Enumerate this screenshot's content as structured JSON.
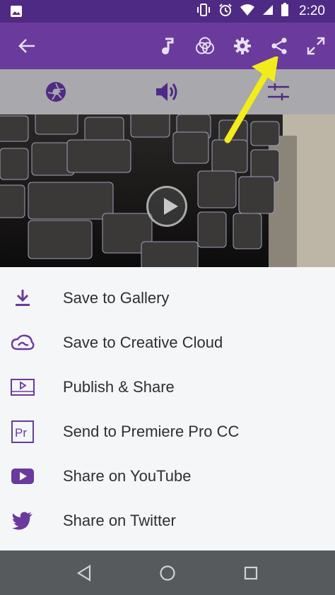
{
  "status_bar": {
    "time": "2:20",
    "icons": [
      "image-icon",
      "vibrate-icon",
      "alarm-icon",
      "wifi-icon",
      "signal-icon",
      "battery-icon"
    ]
  },
  "toolbar": {
    "icons": [
      "back-arrow-icon",
      "music-icon",
      "color-filter-icon",
      "settings-icon",
      "share-icon",
      "fullscreen-icon"
    ]
  },
  "tabs": {
    "icons": [
      "aperture-icon",
      "volume-icon",
      "adjust-sliders-icon"
    ]
  },
  "video": {
    "icons": [
      "play-icon"
    ]
  },
  "share_menu": {
    "items": [
      {
        "label": "Save to Gallery",
        "icon": "download-icon"
      },
      {
        "label": "Save to Creative Cloud",
        "icon": "creative-cloud-icon"
      },
      {
        "label": "Publish & Share",
        "icon": "publish-icon"
      },
      {
        "label": "Send to Premiere Pro CC",
        "icon": "premiere-pro-icon",
        "icon_text": "Pr"
      },
      {
        "label": "Share on YouTube",
        "icon": "youtube-icon"
      },
      {
        "label": "Share on Twitter",
        "icon": "twitter-icon"
      }
    ]
  },
  "nav_bar": {
    "icons": [
      "back-triangle-icon",
      "home-circle-icon",
      "recents-square-icon"
    ]
  },
  "colors": {
    "status_bar": "#4e2a84",
    "toolbar": "#6a3a9c",
    "accent_purple": "#6a3a9c",
    "annotation": "#f2ec1b"
  }
}
